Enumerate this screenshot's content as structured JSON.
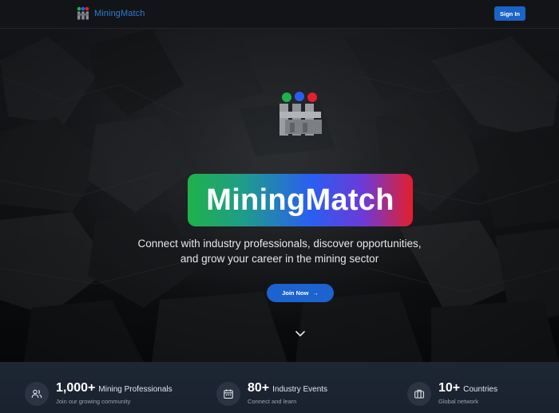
{
  "header": {
    "brand_name": "MiningMatch",
    "signin_label": "Sign In"
  },
  "hero": {
    "title": "MiningMatch",
    "tagline_line1": "Connect with industry professionals, discover opportunities,",
    "tagline_line2": "and grow your career in the mining sector",
    "join_label": "Join Now",
    "join_arrow": "→"
  },
  "stats": [
    {
      "number": "1,000+",
      "label": "Mining Professionals",
      "sub": "Join our growing community",
      "icon": "users-icon"
    },
    {
      "number": "80+",
      "label": "Industry Events",
      "sub": "Connect and learn",
      "icon": "calendar-icon"
    },
    {
      "number": "10+",
      "label": "Countries",
      "sub": "Global network",
      "icon": "briefcase-icon"
    }
  ],
  "colors": {
    "accent": "#1c63d0",
    "brand_text": "#2e7bd6",
    "logo_green": "#1fb24a",
    "logo_blue": "#2a5ef2",
    "logo_red": "#e51e2b"
  }
}
